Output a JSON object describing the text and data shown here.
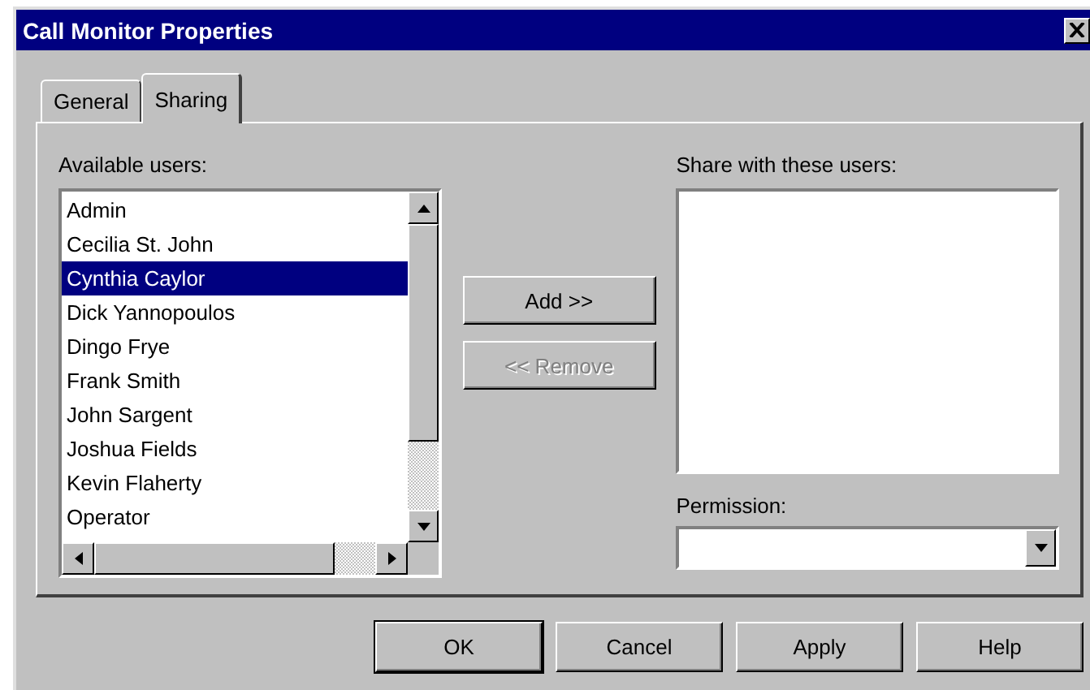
{
  "window": {
    "title": "Call Monitor Properties"
  },
  "tabs": [
    {
      "label": "General",
      "selected": false
    },
    {
      "label": "Sharing",
      "selected": true
    }
  ],
  "available_users": {
    "label": "Available users:",
    "items": [
      {
        "name": "Admin",
        "selected": false
      },
      {
        "name": "Cecilia St. John",
        "selected": false
      },
      {
        "name": "Cynthia Caylor",
        "selected": true
      },
      {
        "name": "Dick Yannopoulos",
        "selected": false
      },
      {
        "name": "Dingo Frye",
        "selected": false
      },
      {
        "name": "Frank Smith",
        "selected": false
      },
      {
        "name": "John Sargent",
        "selected": false
      },
      {
        "name": "Joshua Fields",
        "selected": false
      },
      {
        "name": "Kevin Flaherty",
        "selected": false
      },
      {
        "name": "Operator",
        "selected": false
      }
    ]
  },
  "transfer_buttons": [
    {
      "label": "Add >>",
      "disabled": false
    },
    {
      "label": "<< Remove",
      "disabled": true
    }
  ],
  "share_list": {
    "label": "Share with these users:"
  },
  "permission": {
    "label": "Permission:"
  },
  "buttons": [
    {
      "label": "OK",
      "default": true
    },
    {
      "label": "Cancel",
      "default": false
    },
    {
      "label": "Apply",
      "default": false
    },
    {
      "label": "Help",
      "default": false
    }
  ]
}
